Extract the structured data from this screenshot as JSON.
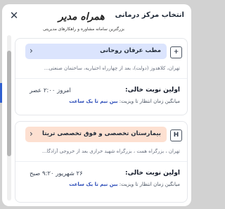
{
  "dialog": {
    "title": "انتخاب مرکز درمانی",
    "close": "✕"
  },
  "watermark": {
    "main": "همراه مدیر",
    "sub": "بزرگترین سامانه مشاوره و راهکارهای مدیریتی"
  },
  "centers": [
    {
      "name": "مطب عرفان روحانی",
      "icon_letter": "+",
      "icon": "clinic-plus-icon",
      "address": "تهران، کلاهدوز (دولت)، بعد از چهارراه اختیاریه، ساختمان صنعتی...",
      "first_slot_label": "اولین نوبت خالی:",
      "first_slot_value": "امروز ۲:۰۰ عصر",
      "wait_prefix": "میانگین زمان انتظار تا ویزیت:",
      "wait_value": "بین نیم تا یک ساعت",
      "accent": "#dbe4fd"
    },
    {
      "name": "بیمارستان تخصصی و فوق تخصصی تریتا",
      "icon_letter": "H",
      "icon": "hospital-h-icon",
      "address": "تهران ، بزرگراه همت ، بزرگراه شهید خرازی بعد از خروجی آزادگا...",
      "first_slot_label": "اولین نوبت خالی:",
      "first_slot_value": "۲۶ شهریور ۹:۲۰ صبح",
      "wait_prefix": "میانگین زمان انتظار تا ویزیت:",
      "wait_value": "بین نیم تا یک ساعت",
      "accent": "#fde0d1"
    }
  ]
}
